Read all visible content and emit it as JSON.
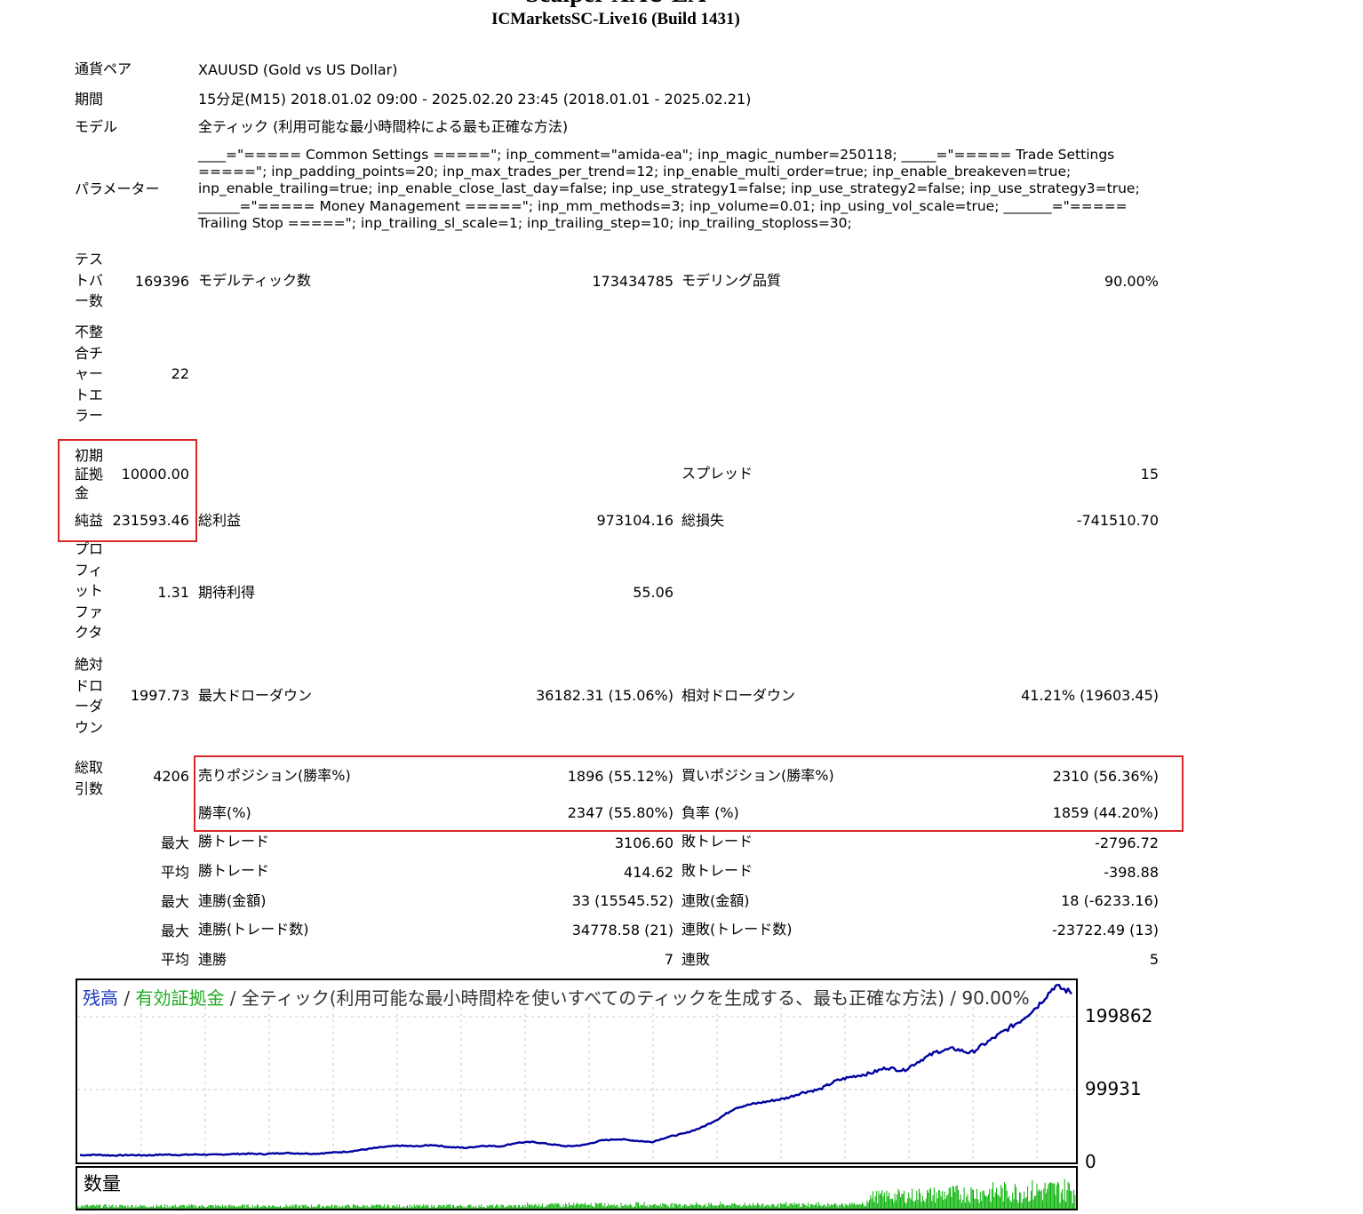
{
  "header": {
    "title": "Scalper XAU EA",
    "subtitle": "ICMarketsSC-Live16 (Build 1431)"
  },
  "info": {
    "symbol_label": "通貨ペア",
    "symbol_value": "XAUUSD (Gold vs US Dollar)",
    "period_label": "期間",
    "period_value": "15分足(M15) 2018.01.02 09:00 - 2025.02.20 23:45 (2018.01.01 - 2025.02.21)",
    "model_label": "モデル",
    "model_value": "全ティック (利用可能な最小時間枠による最も正確な方法)",
    "params_label": "パラメーター",
    "params_value": "____=\"===== Common Settings =====\"; inp_comment=\"amida-ea\"; inp_magic_number=250118; _____=\"===== Trade Settings =====\"; inp_padding_points=20; inp_max_trades_per_trend=12; inp_enable_multi_order=true; inp_enable_breakeven=true; inp_enable_trailing=true; inp_enable_close_last_day=false; inp_use_strategy1=false; inp_use_strategy2=false; inp_use_strategy3=true; ______=\"===== Money Management =====\"; inp_mm_methods=3; inp_volume=0.01; inp_using_vol_scale=true; _______=\"===== Trailing Stop =====\"; inp_trailing_sl_scale=1; inp_trailing_step=10; inp_trailing_stoploss=30;"
  },
  "stats": {
    "bars_label": "テストバー数",
    "bars_value": "169396",
    "ticks_label": "モデルティック数",
    "ticks_value": "173434785",
    "quality_label": "モデリング品質",
    "quality_value": "90.00%",
    "mismatch_label": "不整合チャートエラー",
    "mismatch_value": "22",
    "deposit_label": "初期証拠金",
    "deposit_value": "10000.00",
    "spread_label": "スプレッド",
    "spread_value": "15",
    "net_label": "純益",
    "net_value": "231593.46",
    "gross_profit_label": "総利益",
    "gross_profit_value": "973104.16",
    "gross_loss_label": "総損失",
    "gross_loss_value": "-741510.70",
    "pf_label": "プロフィットファクタ",
    "pf_value": "1.31",
    "expected_label": "期待利得",
    "expected_value": "55.06",
    "abs_dd_label": "絶対ドローダウン",
    "abs_dd_value": "1997.73",
    "max_dd_label": "最大ドローダウン",
    "max_dd_value": "36182.31 (15.06%)",
    "rel_dd_label": "相対ドローダウン",
    "rel_dd_value": "41.21% (19603.45)",
    "trades_label": "総取引数",
    "trades_value": "4206",
    "short_label": "売りポジション(勝率%)",
    "short_value": "1896 (55.12%)",
    "long_label": "買いポジション(勝率%)",
    "long_value": "2310 (56.36%)",
    "win_label": "勝率(%)",
    "win_value": "2347 (55.80%)",
    "loss_label": "負率 (%)",
    "loss_value": "1859 (44.20%)",
    "max1": "最大",
    "lwin1": "勝トレード",
    "vwin1": "3106.60",
    "lloss1": "敗トレード",
    "vloss1": "-2796.72",
    "avg1": "平均",
    "lwin2": "勝トレード",
    "vwin2": "414.62",
    "lloss2": "敗トレード",
    "vloss2": "-398.88",
    "max2": "最大",
    "lwin3": "連勝(金額)",
    "vwin3": "33 (15545.52)",
    "lloss3": "連敗(金額)",
    "vloss3": "18 (-6233.16)",
    "max3": "最大",
    "lwin4": "連勝(トレード数)",
    "vwin4": "34778.58 (21)",
    "lloss4": "連敗(トレード数)",
    "vloss4": "-23722.49 (13)",
    "avg2": "平均",
    "lwin5": "連勝",
    "vwin5": "7",
    "lloss5": "連敗",
    "vloss5": "5"
  },
  "chart": {
    "legend_balance": "残高",
    "legend_sep1": " / ",
    "legend_equity": "有効証拠金",
    "legend_rest": " / 全ティック(利用可能な最小時間枠を使いすべてのティックを生成する、最も正確な方法) / 90.00%",
    "volume_label": "数量",
    "balance_color": "#0000a0",
    "equity_color": "#22aa22",
    "volume_color": "#00b000"
  },
  "chart_data": {
    "type": "line",
    "ylim": [
      0,
      240000
    ],
    "yticks": [
      "199862",
      "99931",
      "0"
    ],
    "ytick_values": [
      199862,
      99931,
      0
    ],
    "series": [
      {
        "values": [
          10000,
          10500,
          9500,
          10200,
          9800,
          10800,
          10300,
          11000,
          10500,
          11500,
          12000,
          11500,
          13000,
          12500,
          12000,
          13500,
          15000,
          18000,
          21000,
          23000,
          22000,
          24000,
          21000,
          20000,
          23000,
          22000,
          27000,
          28000,
          25000,
          22000,
          24000,
          30000,
          32000,
          30000,
          28000,
          35000,
          40000,
          48000,
          60000,
          75000,
          80000,
          84000,
          88000,
          96000,
          100000,
          112000,
          118000,
          122000,
          130000,
          126000,
          140000,
          152000,
          156000,
          150000,
          165000,
          180000,
          195000,
          215000,
          242000,
          233000
        ]
      }
    ]
  }
}
